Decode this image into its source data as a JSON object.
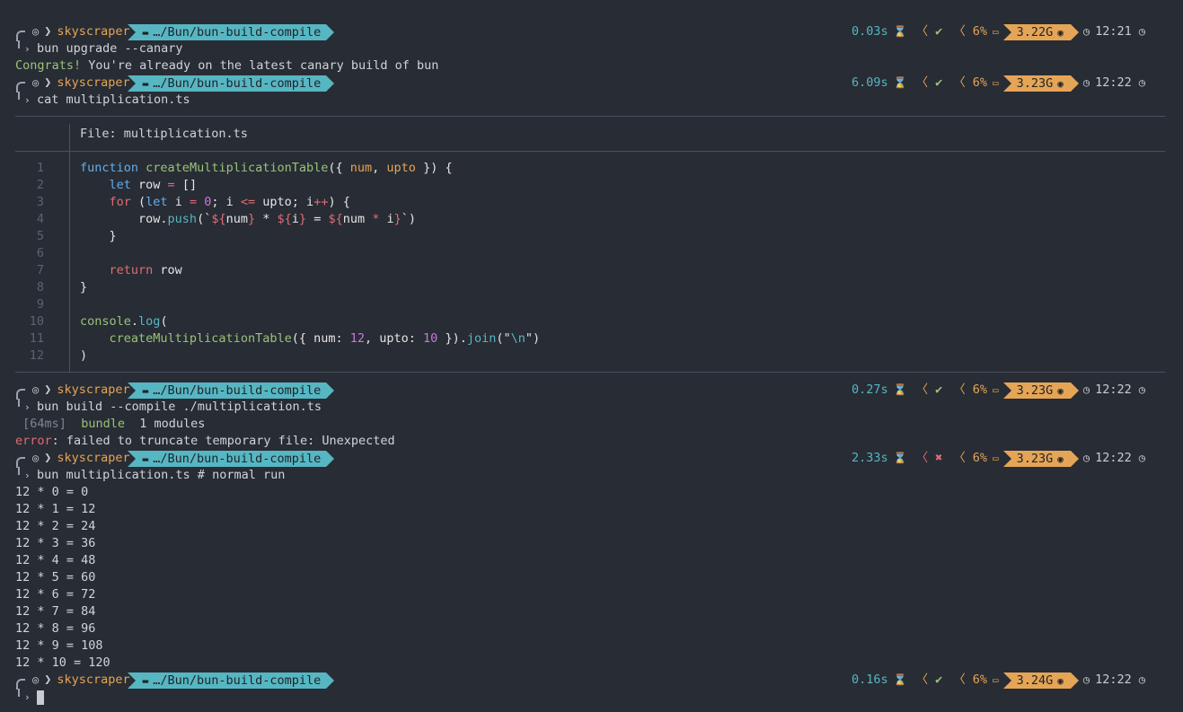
{
  "prompt": {
    "host": "skyscraper",
    "path": "…/Bun/bun-build-compile",
    "cpu": "6%"
  },
  "prompts": [
    {
      "duration": "0.03s",
      "status": "ok",
      "mem": "3.22G",
      "time": "12:21",
      "command": "bun upgrade --canary"
    },
    {
      "duration": "6.09s",
      "status": "ok",
      "mem": "3.23G",
      "time": "12:22",
      "command": "cat multiplication.ts"
    },
    {
      "duration": "0.27s",
      "status": "ok",
      "mem": "3.23G",
      "time": "12:22",
      "command": "bun build --compile ./multiplication.ts"
    },
    {
      "duration": "2.33s",
      "status": "fail",
      "mem": "3.23G",
      "time": "12:22",
      "command": "bun multiplication.ts # normal run"
    },
    {
      "duration": "0.16s",
      "status": "ok",
      "mem": "3.24G",
      "time": "12:22",
      "command": ""
    }
  ],
  "upgrade_output": {
    "congrats": "Congrats!",
    "message": " You're already on the latest canary build of bun"
  },
  "file_header": "File: multiplication.ts",
  "code_line_numbers": [
    "1",
    "2",
    "3",
    "4",
    "5",
    "6",
    "7",
    "8",
    "9",
    "10",
    "11",
    "12"
  ],
  "build_output": {
    "time": "[64ms]",
    "bundle": "bundle",
    "modules": "1 modules",
    "error_label": "error",
    "error_msg": ": failed to truncate temporary file: Unexpected"
  },
  "run_output": [
    "12 * 0 = 0",
    "12 * 1 = 12",
    "12 * 2 = 24",
    "12 * 3 = 36",
    "12 * 4 = 48",
    "12 * 5 = 60",
    "12 * 6 = 72",
    "12 * 7 = 84",
    "12 * 8 = 96",
    "12 * 9 = 108",
    "12 * 10 = 120"
  ],
  "code": {
    "l1": {
      "a": "function",
      "b": " ",
      "c": "createMultiplicationTable",
      "d": "({ ",
      "e": "num",
      "f": ", ",
      "g": "upto",
      "h": " }) {"
    },
    "l2": {
      "a": "    ",
      "b": "let",
      "c": " row ",
      "d": "=",
      "e": " []"
    },
    "l3": {
      "a": "    ",
      "b": "for",
      "c": " (",
      "d": "let",
      "e": " i ",
      "f": "=",
      "g": " ",
      "h": "0",
      "i": "; i ",
      "j": "<=",
      "k": " upto; i",
      "l": "++",
      "m": ") {"
    },
    "l4": {
      "a": "        row.",
      "b": "push",
      "c": "(`",
      "d": "${",
      "e": "num",
      "f": "}",
      "g": " * ",
      "h": "${",
      "i": "i",
      "j": "}",
      "k": " = ",
      "l": "${",
      "m": "num ",
      "n": "*",
      "o": " i",
      "p": "}",
      "q": "`)"
    },
    "l5": {
      "a": "    }"
    },
    "l7": {
      "a": "    ",
      "b": "return",
      "c": " row"
    },
    "l8": {
      "a": "}"
    },
    "l10": {
      "a": "console",
      "b": ".",
      "c": "log",
      "d": "("
    },
    "l11": {
      "a": "    ",
      "b": "createMultiplicationTable",
      "c": "({ num: ",
      "d": "12",
      "e": ", upto: ",
      "f": "10",
      "g": " }).",
      "h": "join",
      "i": "(\"",
      "j": "\\n",
      "k": "\")"
    },
    "l12": {
      "a": ")"
    }
  }
}
